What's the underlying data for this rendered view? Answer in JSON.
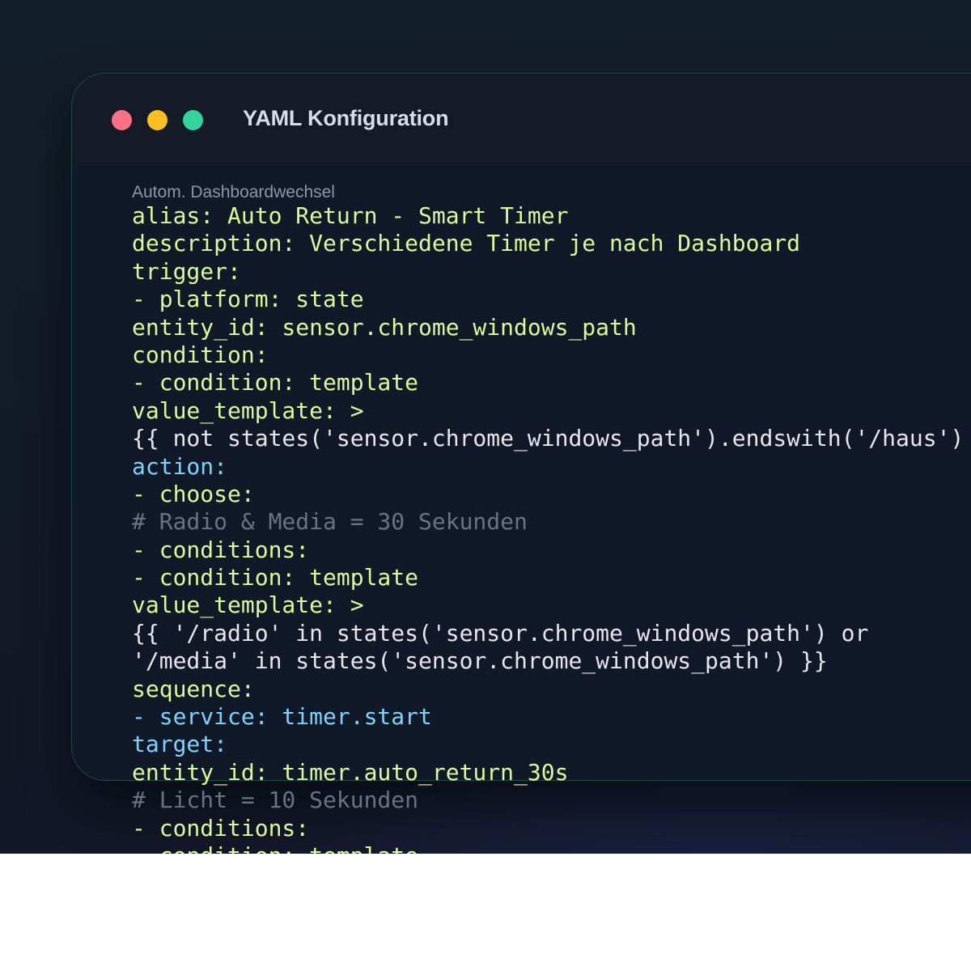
{
  "window": {
    "title": "YAML Konfiguration",
    "controls": [
      {
        "name": "close",
        "color": "#f87185"
      },
      {
        "name": "minimize",
        "color": "#fbbf24"
      },
      {
        "name": "maximize",
        "color": "#34d399"
      }
    ]
  },
  "editor": {
    "caption": "Autom. Dashboardwechsel",
    "colors": {
      "key": "#d9f99d",
      "text": "#e5e7eb",
      "accent": "#7dd3fc",
      "comment": "#6b7280"
    },
    "lines": [
      {
        "text": "alias: Auto Return - Smart Timer",
        "style": "yellow"
      },
      {
        "text": "description: Verschiedene Timer je nach Dashboard",
        "style": "yellow"
      },
      {
        "text": "trigger:",
        "style": "yellow"
      },
      {
        "text": "- platform: state",
        "style": "yellow"
      },
      {
        "text": "entity_id: sensor.chrome_windows_path",
        "style": "yellow"
      },
      {
        "text": "condition:",
        "style": "yellow"
      },
      {
        "text": "- condition: template",
        "style": "yellow"
      },
      {
        "text": "value_template: >",
        "style": "yellow"
      },
      {
        "text": "{{ not states('sensor.chrome_windows_path').endswith('/haus') }}",
        "style": "white"
      },
      {
        "text": "action:",
        "style": "blue"
      },
      {
        "text": "- choose:",
        "style": "yellow"
      },
      {
        "text": "# Radio & Media = 30 Sekunden",
        "style": "comment"
      },
      {
        "text": "- conditions:",
        "style": "yellow"
      },
      {
        "text": "- condition: template",
        "style": "yellow"
      },
      {
        "text": "value_template: >",
        "style": "yellow"
      },
      {
        "text": "{{ '/radio' in states('sensor.chrome_windows_path') or",
        "style": "white"
      },
      {
        "text": "'/media' in states('sensor.chrome_windows_path') }}",
        "style": "white"
      },
      {
        "text": "sequence:",
        "style": "yellow"
      },
      {
        "text": "- service: timer.start",
        "style": "blue"
      },
      {
        "text": "target:",
        "style": "blue"
      },
      {
        "text": "entity_id: timer.auto_return_30s",
        "style": "yellow"
      },
      {
        "text": "# Licht = 10 Sekunden",
        "style": "comment"
      },
      {
        "text": "- conditions:",
        "style": "yellow"
      },
      {
        "text": "- condition: template",
        "style": "yellow"
      }
    ]
  }
}
